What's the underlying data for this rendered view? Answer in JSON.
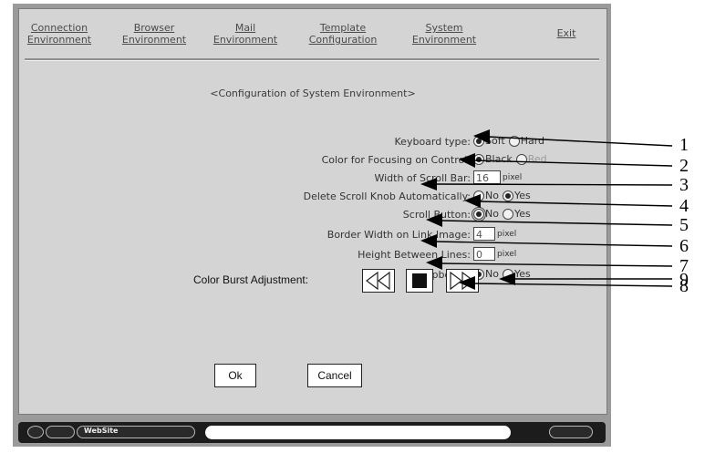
{
  "menu": {
    "connection": [
      "Connection",
      "Environment"
    ],
    "browser": [
      "Browser",
      "Environment"
    ],
    "mail": [
      "Mail",
      "Environment"
    ],
    "template": [
      "Template",
      "Configuration"
    ],
    "system": [
      "System",
      "Environment"
    ],
    "exit": "Exit"
  },
  "page_title": "<Configuration of System Environment>",
  "settings": {
    "keyboard_type": {
      "label": "Keyboard type:",
      "options": [
        "Soft",
        "Hard"
      ],
      "selected": "Soft"
    },
    "focus_color": {
      "label": "Color for Focusing on Control:",
      "options": [
        "Black",
        "Red"
      ],
      "selected": "Black"
    },
    "scroll_bar_width": {
      "label": "Width of Scroll Bar:",
      "value": "16",
      "unit": "pixel"
    },
    "delete_scroll_knob": {
      "label": "Delete Scroll Knob Automatically:",
      "options": [
        "No",
        "Yes"
      ],
      "selected": "Yes"
    },
    "scroll_button": {
      "label": "Scroll Button:",
      "options": [
        "No",
        "Yes"
      ],
      "selected": "No"
    },
    "link_border_width": {
      "label": "Border Width on Link Image:",
      "value": "4",
      "unit": "pixel"
    },
    "line_height": {
      "label": "Height Between Lines:",
      "value": "0",
      "unit": "pixel"
    },
    "clipboard": {
      "label": "Clipboard:",
      "options": [
        "No",
        "Yes"
      ],
      "selected": "No"
    }
  },
  "color_burst": {
    "label": "Color Burst Adjustment:",
    "icons": [
      "rewind-icon",
      "stop-icon",
      "fast-forward-icon"
    ]
  },
  "buttons": {
    "ok": "Ok",
    "cancel": "Cancel"
  },
  "statusbar": {
    "app_name": "WebSite"
  },
  "callouts": [
    "1",
    "2",
    "3",
    "4",
    "5",
    "6",
    "7",
    "8",
    "9"
  ]
}
